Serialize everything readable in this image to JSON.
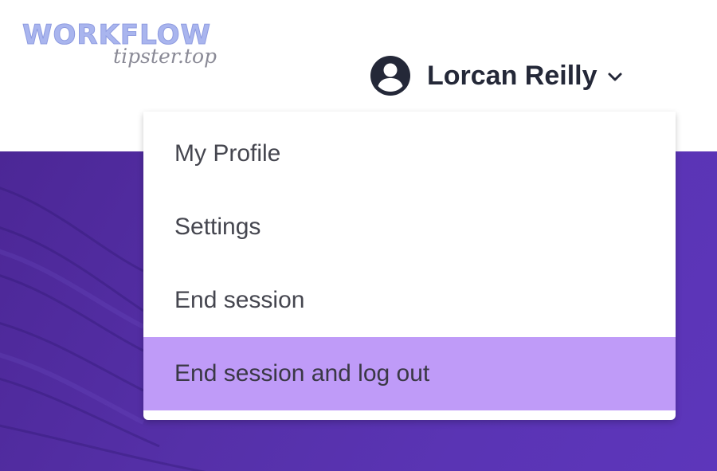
{
  "watermark": {
    "title": "WORKFLOW",
    "subtitle": "tipster.top"
  },
  "user_menu": {
    "name": "Lorcan Reilly",
    "avatar_icon": "user-circle-icon",
    "chevron_icon": "chevron-down-icon",
    "items": [
      {
        "label": "My Profile"
      },
      {
        "label": "Settings"
      },
      {
        "label": "End session"
      },
      {
        "label": "End session and log out"
      }
    ],
    "highlighted_item": "End session and log out"
  },
  "colors": {
    "hero_purple": "#5530a8",
    "highlight": "#bf9bf8",
    "text": "#242838"
  }
}
